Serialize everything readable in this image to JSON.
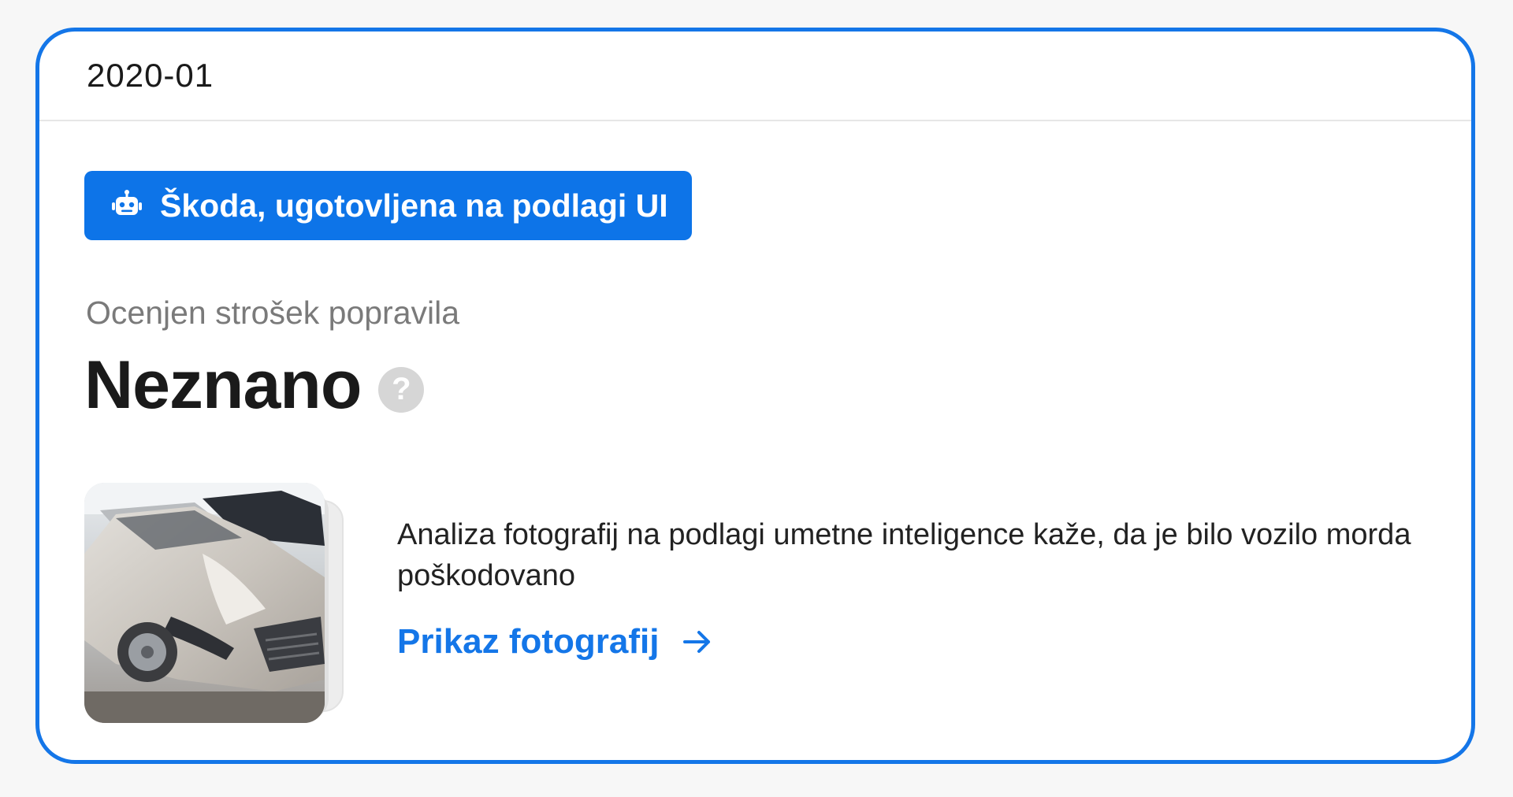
{
  "card": {
    "period": "2020-01",
    "ai_badge": {
      "icon": "robot-icon",
      "label": "Škoda, ugotovljena na podlagi UI"
    },
    "cost_label": "Ocenjen strošek popravila",
    "cost_value": "Neznano",
    "help_icon": "question-icon",
    "help_glyph": "?",
    "photo": {
      "subject": "damaged silver car front"
    },
    "analysis_text": "Analiza fotografij na podlagi umetne inteligence kaže, da je bilo vozilo morda poškodovano",
    "photos_link": {
      "label": "Prikaz fotografij",
      "icon": "arrow-right-icon"
    }
  },
  "colors": {
    "accent": "#1476e8",
    "badge_bg": "#0d74e8",
    "muted_text": "#7a7a7a",
    "help_icon_bg": "#d6d6d6"
  }
}
